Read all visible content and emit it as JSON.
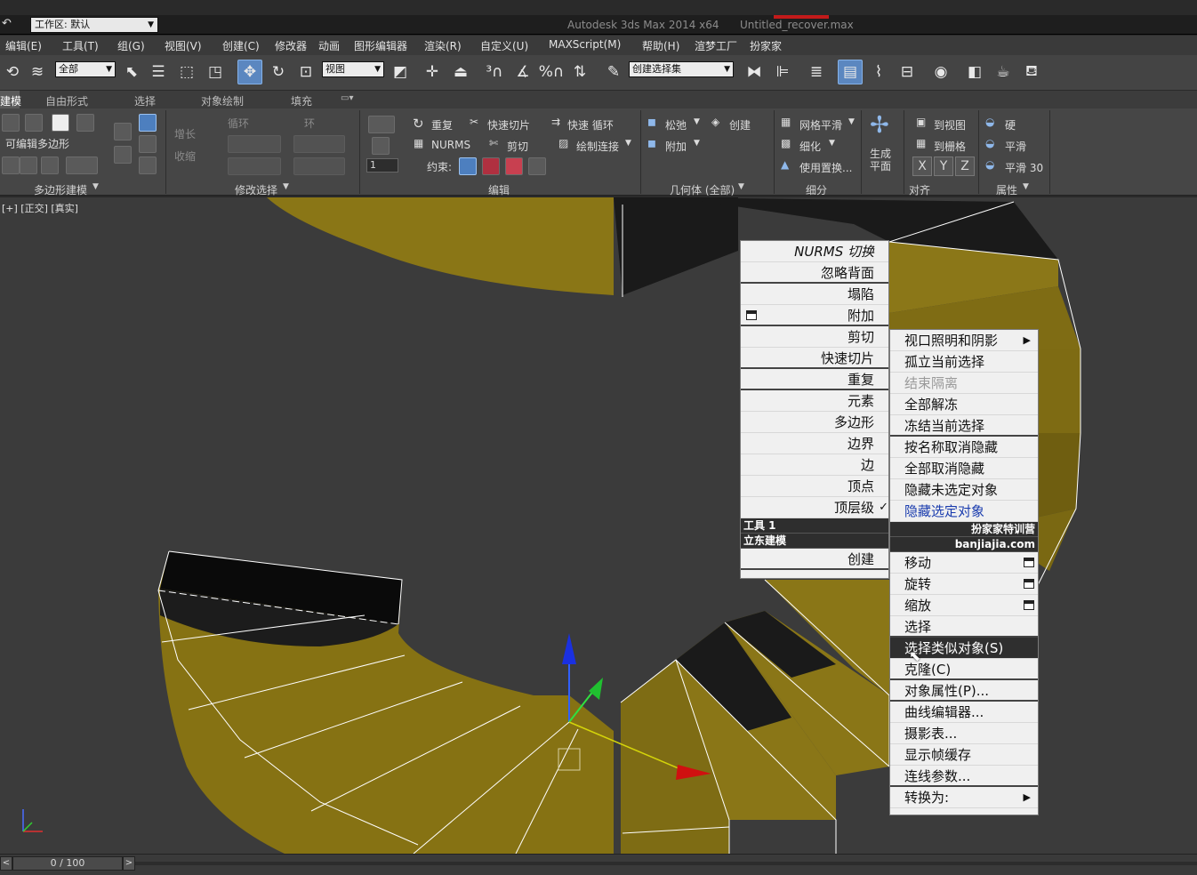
{
  "titlebar": {
    "workspace_label": "工作区: 默认",
    "title": "Autodesk 3ds Max  2014 x64",
    "filename": "Untitled_recover.max"
  },
  "menubar": [
    "编辑(E)",
    "工具(T)",
    "组(G)",
    "视图(V)",
    "创建(C)",
    "修改器",
    "动画",
    "图形编辑器",
    "渲染(R)",
    "自定义(U)",
    "MAXScript(M)",
    "帮助(H)",
    "渲梦工厂",
    "扮家家"
  ],
  "toolbar": {
    "filter_select": "全部",
    "refcoord_select": "视图",
    "named_selection": "创建选择集"
  },
  "ribbon_tabs": [
    "建模",
    "自由形式",
    "选择",
    "对象绘制",
    "填充"
  ],
  "ribbon": {
    "editable_poly_label": "可编辑多边形",
    "grow_label": "增长",
    "shrink_label": "收缩",
    "loop_label": "循环",
    "ring_label": "环",
    "repeat_label": "重复",
    "quickslice_label": "快速切片",
    "quickloop_label": "快速 循环",
    "nurms_label": "NURMS",
    "cut_label": "剪切",
    "paintconnect_label": "绘制连接",
    "constraint_label": "约束:",
    "spin_value": "1",
    "relax_label": "松弛",
    "create_label": "创建",
    "attach_label": "附加",
    "meshsmooth_label": "网格平滑",
    "tessellate_label": "细化",
    "usedisplace_label": "使用置换...",
    "generate_plane_label": "生成平面",
    "to_view_label": "到视图",
    "to_grid_label": "到栅格",
    "x_label": "X",
    "y_label": "Y",
    "z_label": "Z",
    "hard_label": "硬",
    "smooth_label": "平滑",
    "smooth30_label": "平滑 30",
    "groups": [
      "多边形建模",
      "修改选择",
      "编辑",
      "几何体 (全部)",
      "细分",
      "对齐",
      "属性"
    ]
  },
  "viewport": {
    "label": "[+] [正交] [真实]"
  },
  "quadmenu": {
    "left_top": [
      {
        "label": "NURMS 切换",
        "sep": false
      },
      {
        "label": "忽略背面",
        "sep": true
      },
      {
        "label": "塌陷",
        "sep": false
      },
      {
        "label": "附加",
        "sep": true,
        "box": true
      },
      {
        "label": "剪切",
        "sep": false
      },
      {
        "label": "快速切片",
        "sep": true
      },
      {
        "label": "重复",
        "sep": true
      },
      {
        "label": "元素",
        "sep": false
      },
      {
        "label": "多边形",
        "sep": false
      },
      {
        "label": "边界",
        "sep": false
      },
      {
        "label": "边",
        "sep": false
      },
      {
        "label": "顶点",
        "sep": false
      },
      {
        "label": "顶层级",
        "sep": false,
        "check": "✓"
      }
    ],
    "right_top": [
      {
        "label": "视口照明和阴影",
        "sub": "▶"
      },
      {
        "label": "孤立当前选择"
      },
      {
        "label": "结束隔离",
        "disabled": true
      },
      {
        "label": "全部解冻"
      },
      {
        "label": "冻结当前选择",
        "sep": true
      },
      {
        "label": "按名称取消隐藏"
      },
      {
        "label": "全部取消隐藏"
      },
      {
        "label": "隐藏未选定对象"
      },
      {
        "label": "隐藏选定对象",
        "blue": true
      }
    ],
    "headers": {
      "left_top": "工具 1",
      "right_top": "扮家家特训营",
      "left_bottom": "立东建模",
      "right_bottom": "banjiajia.com"
    },
    "left_bottom": [
      {
        "label": "创建"
      }
    ],
    "right_bottom": [
      {
        "label": "移动",
        "box": true
      },
      {
        "label": "旋转",
        "box": true
      },
      {
        "label": "缩放",
        "box": true
      },
      {
        "label": "选择",
        "sep": true
      },
      {
        "label": "选择类似对象(S)",
        "highlight": true
      },
      {
        "label": "克隆(C)",
        "sep": true
      },
      {
        "label": "对象属性(P)...",
        "sep": true
      },
      {
        "label": "曲线编辑器..."
      },
      {
        "label": "摄影表..."
      },
      {
        "label": "显示帧缓存"
      },
      {
        "label": "连线参数...",
        "sep": true
      },
      {
        "label": "转换为:",
        "sub": "▶"
      }
    ]
  },
  "status": {
    "frame_label": "0 / 100"
  },
  "colors": {
    "stair_face": "#7c6a14",
    "stair_top": "#a08a1c",
    "viewport_bg": "#3b3b3b",
    "active_blue": "#5b87c0"
  }
}
